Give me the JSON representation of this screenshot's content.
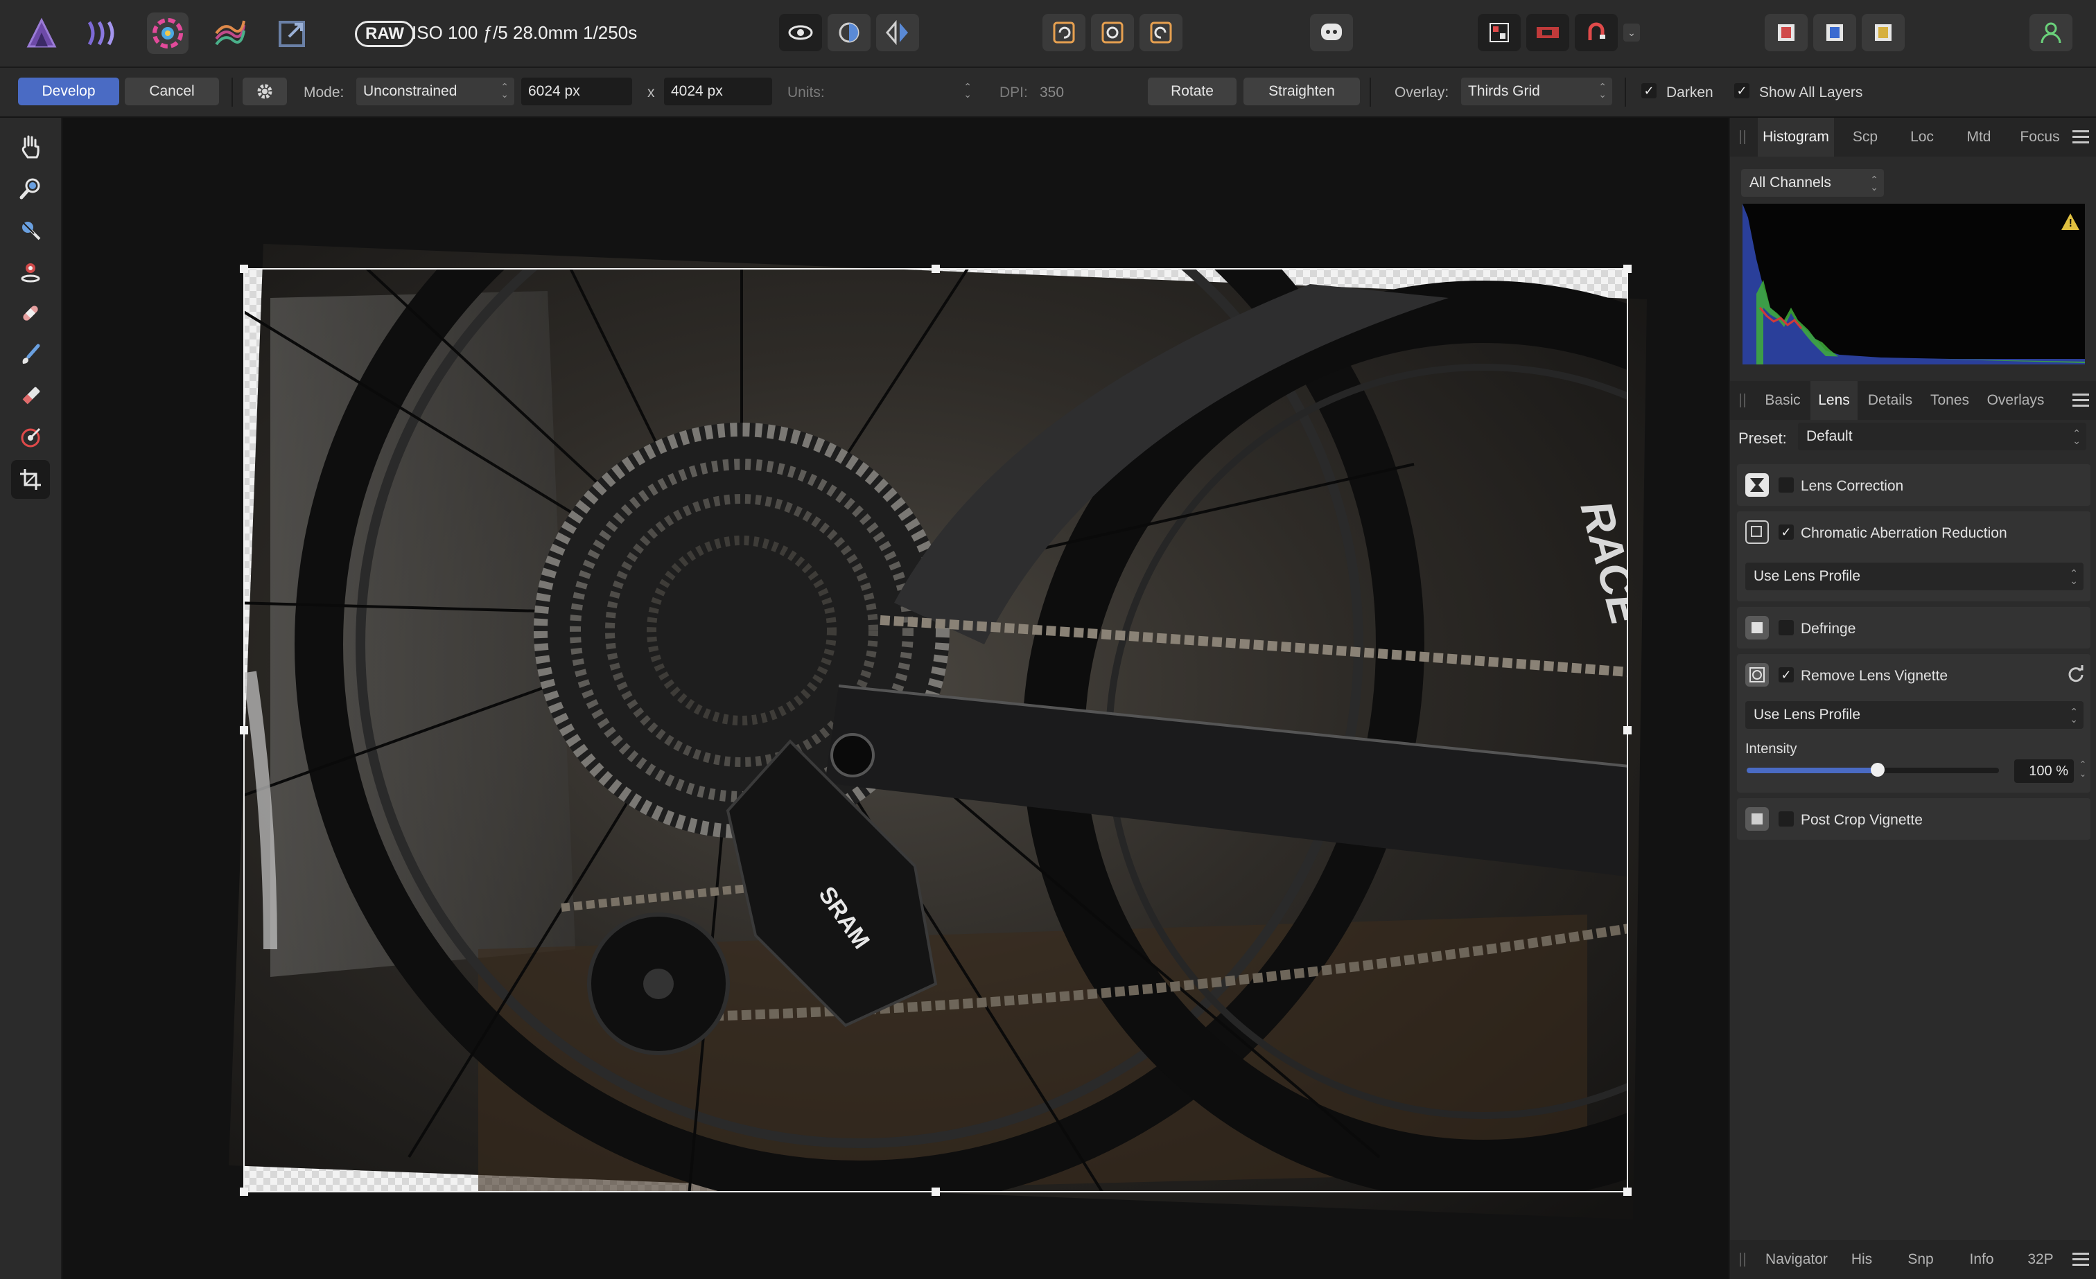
{
  "topbar": {
    "raw_badge": "RAW",
    "exif": "ISO 100 ƒ/5 28.0mm 1/250s"
  },
  "context_bar": {
    "develop_label": "Develop",
    "cancel_label": "Cancel",
    "mode_label": "Mode:",
    "mode_value": "Unconstrained",
    "width_value": "6024 px",
    "x_label": "x",
    "height_value": "4024 px",
    "units_label": "Units:",
    "dpi_label": "DPI:",
    "dpi_value": "350",
    "rotate_label": "Rotate",
    "straighten_label": "Straighten",
    "overlay_label": "Overlay:",
    "overlay_value": "Thirds Grid",
    "darken_label": "Darken",
    "darken_checked": true,
    "show_all_layers_label": "Show All Layers",
    "show_all_layers_checked": true
  },
  "histogram_panel": {
    "tabs": [
      "Histogram",
      "Scp",
      "Loc",
      "Mtd",
      "Focus"
    ],
    "selected_tab": "Histogram",
    "channels_value": "All Channels"
  },
  "develop_panel": {
    "tabs": [
      "Basic",
      "Lens",
      "Details",
      "Tones",
      "Overlays"
    ],
    "selected_tab": "Lens",
    "preset_label": "Preset:",
    "preset_value": "Default",
    "sections": {
      "lens_correction": "Lens Correction",
      "chromatic_aberration": "Chromatic Aberration Reduction",
      "chromatic_profile": "Use Lens Profile",
      "defringe": "Defringe",
      "remove_vignette": "Remove Lens Vignette",
      "vignette_profile": "Use Lens Profile",
      "intensity_label": "Intensity",
      "intensity_value": "100 %",
      "intensity_fraction": 0.52,
      "post_crop_vignette": "Post Crop Vignette"
    }
  },
  "bottom_panel": {
    "tabs": [
      "Navigator",
      "His",
      "Snp",
      "Info",
      "32P"
    ]
  },
  "colors": {
    "accent": "#4a6bc4",
    "panel_bg": "#2b2b2b",
    "canvas_bg": "#121212",
    "histogram_blue": "#2a3f9a",
    "histogram_green": "#3fae3a"
  }
}
